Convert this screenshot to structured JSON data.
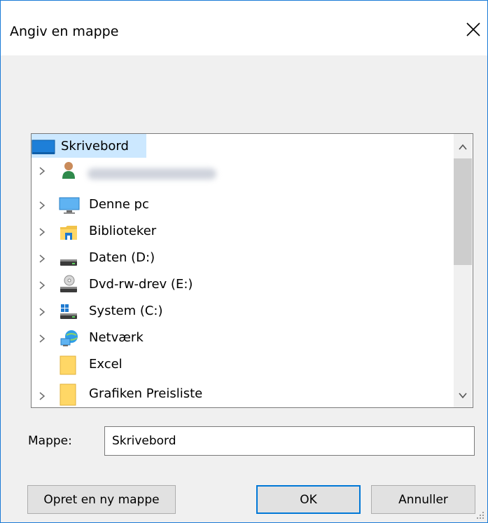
{
  "window": {
    "title": "Angiv en mappe"
  },
  "tree": {
    "items": [
      {
        "label": "Skrivebord",
        "icon": "desktop-icon",
        "selected": true,
        "expandable": false
      },
      {
        "label": "",
        "icon": "user-icon",
        "expandable": true,
        "blurred": true
      },
      {
        "label": "Denne pc",
        "icon": "computer-icon",
        "expandable": true
      },
      {
        "label": "Biblioteker",
        "icon": "library-folder-icon",
        "expandable": true
      },
      {
        "label": "Daten (D:)",
        "icon": "drive-icon",
        "expandable": true
      },
      {
        "label": "Dvd-rw-drev (E:)",
        "icon": "dvd-drive-icon",
        "expandable": true
      },
      {
        "label": "System (C:)",
        "icon": "system-drive-icon",
        "expandable": true
      },
      {
        "label": "Netværk",
        "icon": "network-icon",
        "expandable": true
      },
      {
        "label": "Excel",
        "icon": "folder-icon",
        "expandable": false
      },
      {
        "label": "Grafiken Preisliste",
        "icon": "folder-icon",
        "expandable": true
      }
    ]
  },
  "folder": {
    "label": "Mappe:",
    "value": "Skrivebord"
  },
  "buttons": {
    "new_folder": "Opret en ny mappe",
    "ok": "OK",
    "cancel": "Annuller"
  },
  "colors": {
    "selection": "#cce8ff",
    "accent": "#0078d7",
    "folder": "#ffd766"
  }
}
